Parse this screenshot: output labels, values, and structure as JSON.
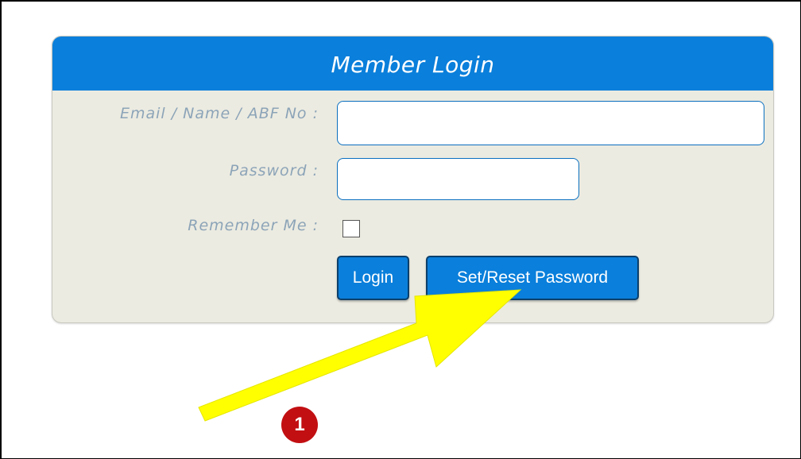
{
  "login": {
    "title": "Member Login",
    "fields": {
      "identifier_label": "Email / Name / ABF No :",
      "identifier_value": "",
      "password_label": "Password :",
      "password_value": "",
      "remember_label": "Remember Me :"
    },
    "buttons": {
      "login": "Login",
      "reset": "Set/Reset Password"
    }
  },
  "annotation": {
    "step_number": "1",
    "arrow_color": "#ffff00",
    "badge_color": "#c20f12"
  },
  "theme": {
    "accent": "#0a7fdb",
    "panel_bg": "#ecebe1",
    "label_color": "#8ca4b8"
  }
}
